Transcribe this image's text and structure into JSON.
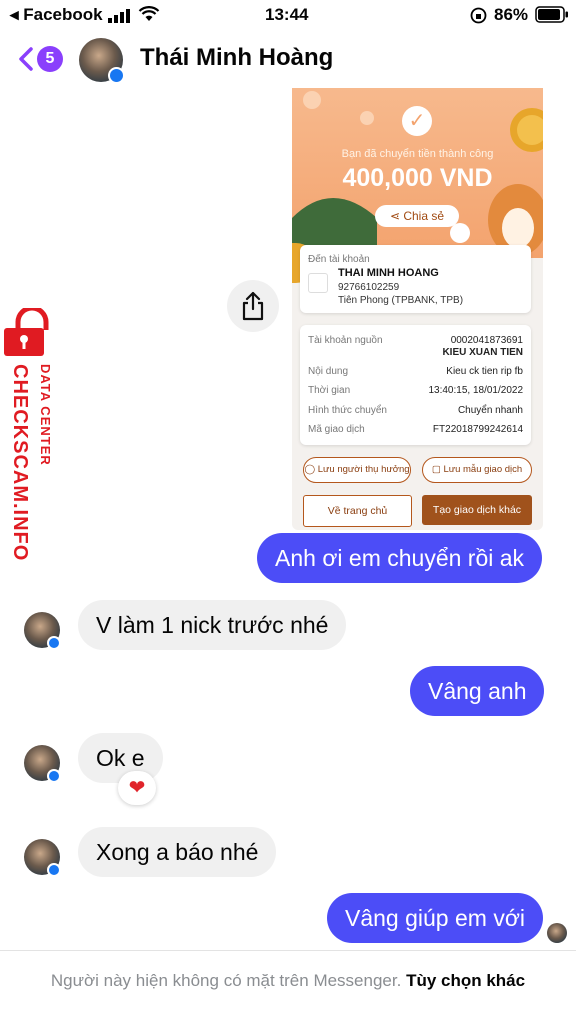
{
  "status_bar": {
    "back_app": "◂ Facebook",
    "time": "13:44",
    "battery": "86%"
  },
  "header": {
    "unread_count": "5",
    "contact_name": "Thái Minh Hoàng"
  },
  "receipt": {
    "success_text": "Bạn đã chuyển tiền thành công",
    "amount": "400,000 VND",
    "share_label": "Chia sẻ",
    "to_account_label": "Đến tài khoản",
    "recipient_name": "THAI MINH HOANG",
    "recipient_account": "92766102259",
    "recipient_bank": "Tiên Phong (TPBANK, TPB)",
    "details": [
      {
        "key": "Tài khoản nguồn",
        "value": "0002041873691"
      },
      {
        "key": "",
        "value": "KIEU XUAN TIEN"
      },
      {
        "key": "Nội dung",
        "value": "Kieu ck tien rip fb"
      },
      {
        "key": "Thời gian",
        "value": "13:40:15, 18/01/2022"
      },
      {
        "key": "Hình thức chuyển",
        "value": "Chuyển nhanh"
      },
      {
        "key": "Mã giao dịch",
        "value": "FT22018799242614"
      }
    ],
    "save_recipient_label": "Lưu người thụ hưởng",
    "save_template_label": "Lưu mẫu giao dịch",
    "home_label": "Về trang chủ",
    "new_transaction_label": "Tạo giao dịch khác"
  },
  "watermark": {
    "line1": "DATA CENTER",
    "line2": "CHECKSCAM.INFO"
  },
  "messages": [
    {
      "text": "Anh ơi em chuyển rồi ak",
      "direction": "out"
    },
    {
      "text": "V làm 1 nick trước nhé",
      "direction": "in"
    },
    {
      "text": "Vâng anh",
      "direction": "out"
    },
    {
      "text": "Ok e",
      "direction": "in",
      "reaction": "heart"
    },
    {
      "text": "Xong a báo nhé",
      "direction": "in"
    },
    {
      "text": "Vâng giúp em với",
      "direction": "out"
    }
  ],
  "footer": {
    "notice": "Người này hiện không có mặt trên Messenger.",
    "options": "Tùy chọn khác"
  },
  "colors": {
    "outgoing_bubble": "#4c4df7",
    "incoming_bubble": "#f0f0f0",
    "accent": "#8a3ffc",
    "receipt_orange": "#f3a36e",
    "receipt_brown": "#8a3e10"
  }
}
